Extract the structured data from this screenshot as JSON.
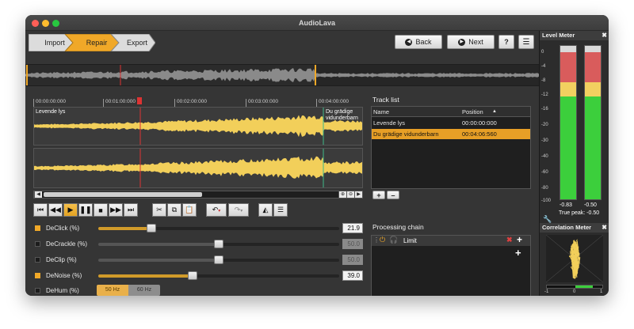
{
  "window": {
    "title": "AudioLava"
  },
  "colors": {
    "accent": "#f0a828",
    "selection": "#e79f26",
    "meter_green": "#3ccf3c",
    "meter_yellow": "#f2d060",
    "meter_red": "#d95c5c"
  },
  "steps": [
    {
      "label": "Import",
      "active": false
    },
    {
      "label": "Repair",
      "active": true
    },
    {
      "label": "Export",
      "active": false
    }
  ],
  "toolbar": {
    "back_label": "Back",
    "next_label": "Next",
    "help_label": "?",
    "list_icon": "list-icon"
  },
  "timeline": {
    "ticks": [
      "00:00:00:000",
      "00:01:00:000",
      "00:02:00:000",
      "00:03:00:000",
      "00:04:00:000"
    ]
  },
  "waveform": {
    "track1_label": "Levende lys",
    "track2_label": "Du grädige vidunderbarn"
  },
  "transport": {
    "buttons": [
      "skip-start-icon",
      "rewind-icon",
      "play-icon",
      "pause-icon",
      "stop-icon",
      "fast-forward-icon",
      "skip-end-icon"
    ],
    "edit_buttons": [
      "cut-icon",
      "copy-icon",
      "paste-icon"
    ],
    "history_buttons": [
      "undo-icon",
      "redo-icon"
    ],
    "view_buttons": [
      "spectrum-icon",
      "list-view-icon"
    ]
  },
  "params": [
    {
      "label": "DeClick (%)",
      "value": "21.9",
      "checked": true,
      "fraction": 0.219
    },
    {
      "label": "DeCrackle (%)",
      "value": "50.0",
      "checked": false,
      "fraction": 0.5
    },
    {
      "label": "DeClip (%)",
      "value": "50.0",
      "checked": false,
      "fraction": 0.5
    },
    {
      "label": "DeNoise (%)",
      "value": "39.0",
      "checked": true,
      "fraction": 0.39
    }
  ],
  "dehum": {
    "label": "DeHum (%)",
    "options": [
      "50 Hz",
      "60 Hz"
    ],
    "selected": "50 Hz"
  },
  "track_list": {
    "title": "Track list",
    "columns": [
      "Name",
      "Position"
    ],
    "rows": [
      {
        "name": "Levende lys",
        "position": "00:00:00:000",
        "selected": false
      },
      {
        "name": "Du grädige vidunderbarn",
        "position": "00:04:06:560",
        "selected": true
      }
    ],
    "add_label": "+",
    "remove_label": "–"
  },
  "processing_chain": {
    "title": "Processing chain",
    "item": "Limit",
    "add_label": "+"
  },
  "level_meter": {
    "title": "Level Meter",
    "scale": [
      "0",
      "-4",
      "-8",
      "-12",
      "-16",
      "-20",
      "-30",
      "-40",
      "-60",
      "-80",
      "-100"
    ],
    "left_value": "-0.83",
    "right_value": "-0.50",
    "true_peak": "True peak: -0.50"
  },
  "correlation_meter": {
    "title": "Correlation Meter",
    "scale": [
      "-1",
      "0",
      "1"
    ]
  }
}
